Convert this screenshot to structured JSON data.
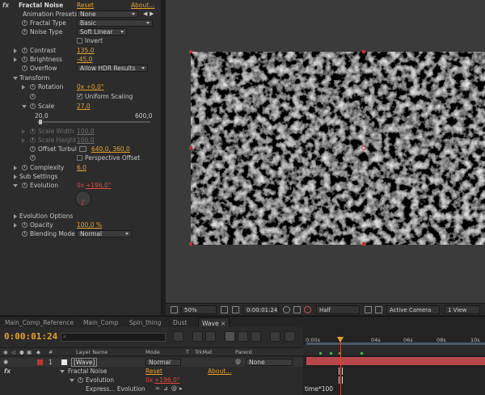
{
  "effects": {
    "effect_name": "Fractal Noise",
    "reset": "Reset",
    "about": "About...",
    "animation_presets_label": "Animation Presets:",
    "animation_presets_value": "None",
    "fractal_type_label": "Fractal Type",
    "fractal_type_value": "Basic",
    "noise_type_label": "Noise Type",
    "noise_type_value": "Soft Linear",
    "invert_label": "Invert",
    "contrast_label": "Contrast",
    "contrast_value": "135,0",
    "brightness_label": "Brightness",
    "brightness_value": "-45,0",
    "overflow_label": "Overflow",
    "overflow_value": "Allow HDR Results",
    "transform_label": "Transform",
    "rotation_label": "Rotation",
    "rotation_value": "0x +0,0°",
    "uniform_scaling_label": "Uniform Scaling",
    "scale_label": "Scale",
    "scale_value": "27,0",
    "scale_min": "20,0",
    "scale_max": "600,0",
    "scale_slider_fraction": 0.012,
    "scale_width_label": "Scale Width",
    "scale_width_value": "100,0",
    "scale_height_label": "Scale Height",
    "scale_height_value": "100,0",
    "offset_turbulence_label": "Offset Turbul",
    "offset_turbulence_value": "640,0, 360,0",
    "perspective_offset_label": "Perspective Offset",
    "complexity_label": "Complexity",
    "complexity_value": "6,0",
    "sub_settings_label": "Sub Settings",
    "evolution_label": "Evolution",
    "evolution_value_prefix": "0x",
    "evolution_value": "+196,0°",
    "evolution_options_label": "Evolution Options",
    "opacity_label": "Opacity",
    "opacity_value": "100,0 %",
    "blending_mode_label": "Blending Mode",
    "blending_mode_value": "Normal"
  },
  "viewer": {
    "zoom": "50%",
    "timecode": "0:00:01:24",
    "resolution": "Half",
    "camera": "Active Camera",
    "view_count": "1 View"
  },
  "tabs": [
    {
      "label": "Main_Comp_Reference"
    },
    {
      "label": "Main_Comp"
    },
    {
      "label": "Spin_thing"
    },
    {
      "label": "Dust"
    },
    {
      "label": "Wave"
    }
  ],
  "timeline": {
    "timecode": "0:00:01:24",
    "col_layer_name": "Layer Name",
    "col_mode": "Mode",
    "col_t": "T",
    "col_trkmat": "TrkMat",
    "col_parent": "Parent",
    "layer_number": "1",
    "layer_name": "[Wave]",
    "layer_mode": "Normal",
    "layer_parent": "None",
    "effect_row_name": "Fractal Noise",
    "effect_reset": "Reset",
    "effect_about": "About...",
    "evolution_label": "Evolution",
    "evolution_value_prefix": "0x",
    "evolution_value": "+196,0°",
    "expression_label": "Express... Evolution",
    "expression_text": "time*100",
    "ruler": [
      "0:00s",
      "04s",
      "06s",
      "08s",
      "10s"
    ]
  }
}
